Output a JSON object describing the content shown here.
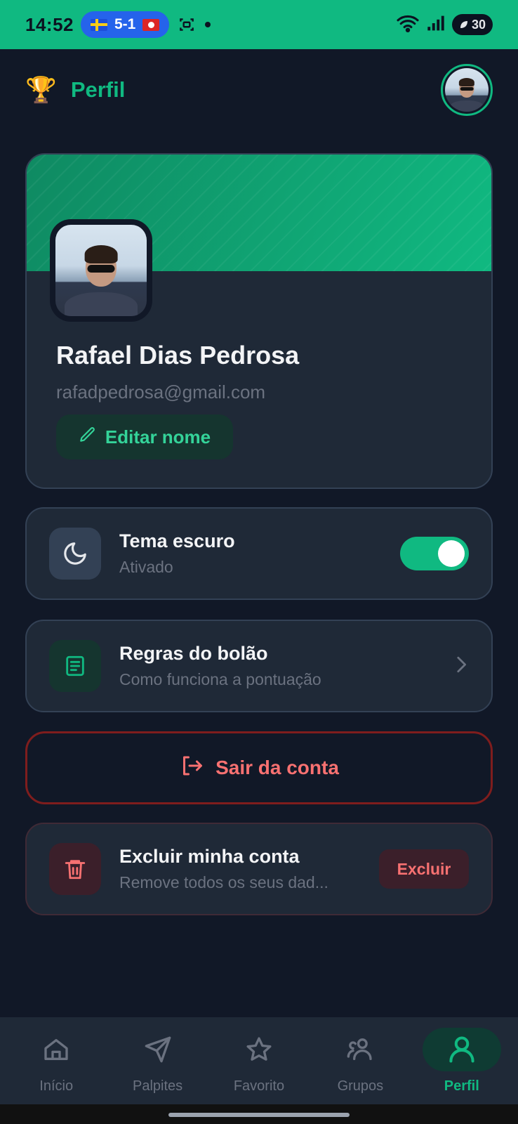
{
  "status_bar": {
    "time": "14:52",
    "score": "5-1",
    "battery": "30"
  },
  "header": {
    "title": "Perfil",
    "logo_icon": "trophy-icon",
    "avatar_icon": "user-avatar"
  },
  "profile": {
    "name": "Rafael Dias Pedrosa",
    "email": "rafadpedrosa@gmail.com",
    "edit_label": "Editar nome"
  },
  "settings": {
    "theme": {
      "title": "Tema escuro",
      "subtitle": "Ativado",
      "icon": "moon-icon",
      "enabled": true
    },
    "rules": {
      "title": "Regras do bolão",
      "subtitle": "Como funciona a pontuação",
      "icon": "book-icon"
    }
  },
  "logout": {
    "label": "Sair da conta",
    "icon": "logout-icon"
  },
  "delete_account": {
    "title": "Excluir minha conta",
    "subtitle": "Remove todos os seus dad...",
    "button_label": "Excluir",
    "icon": "trash-icon"
  },
  "bottom_nav": {
    "items": [
      {
        "label": "Início",
        "icon": "home-icon"
      },
      {
        "label": "Palpites",
        "icon": "send-icon"
      },
      {
        "label": "Favorito",
        "icon": "star-icon"
      },
      {
        "label": "Grupos",
        "icon": "users-icon"
      },
      {
        "label": "Perfil",
        "icon": "user-icon"
      }
    ],
    "active_index": 4
  },
  "colors": {
    "accent": "#10b981",
    "background": "#111827",
    "card": "#1f2937",
    "danger": "#f87171"
  }
}
